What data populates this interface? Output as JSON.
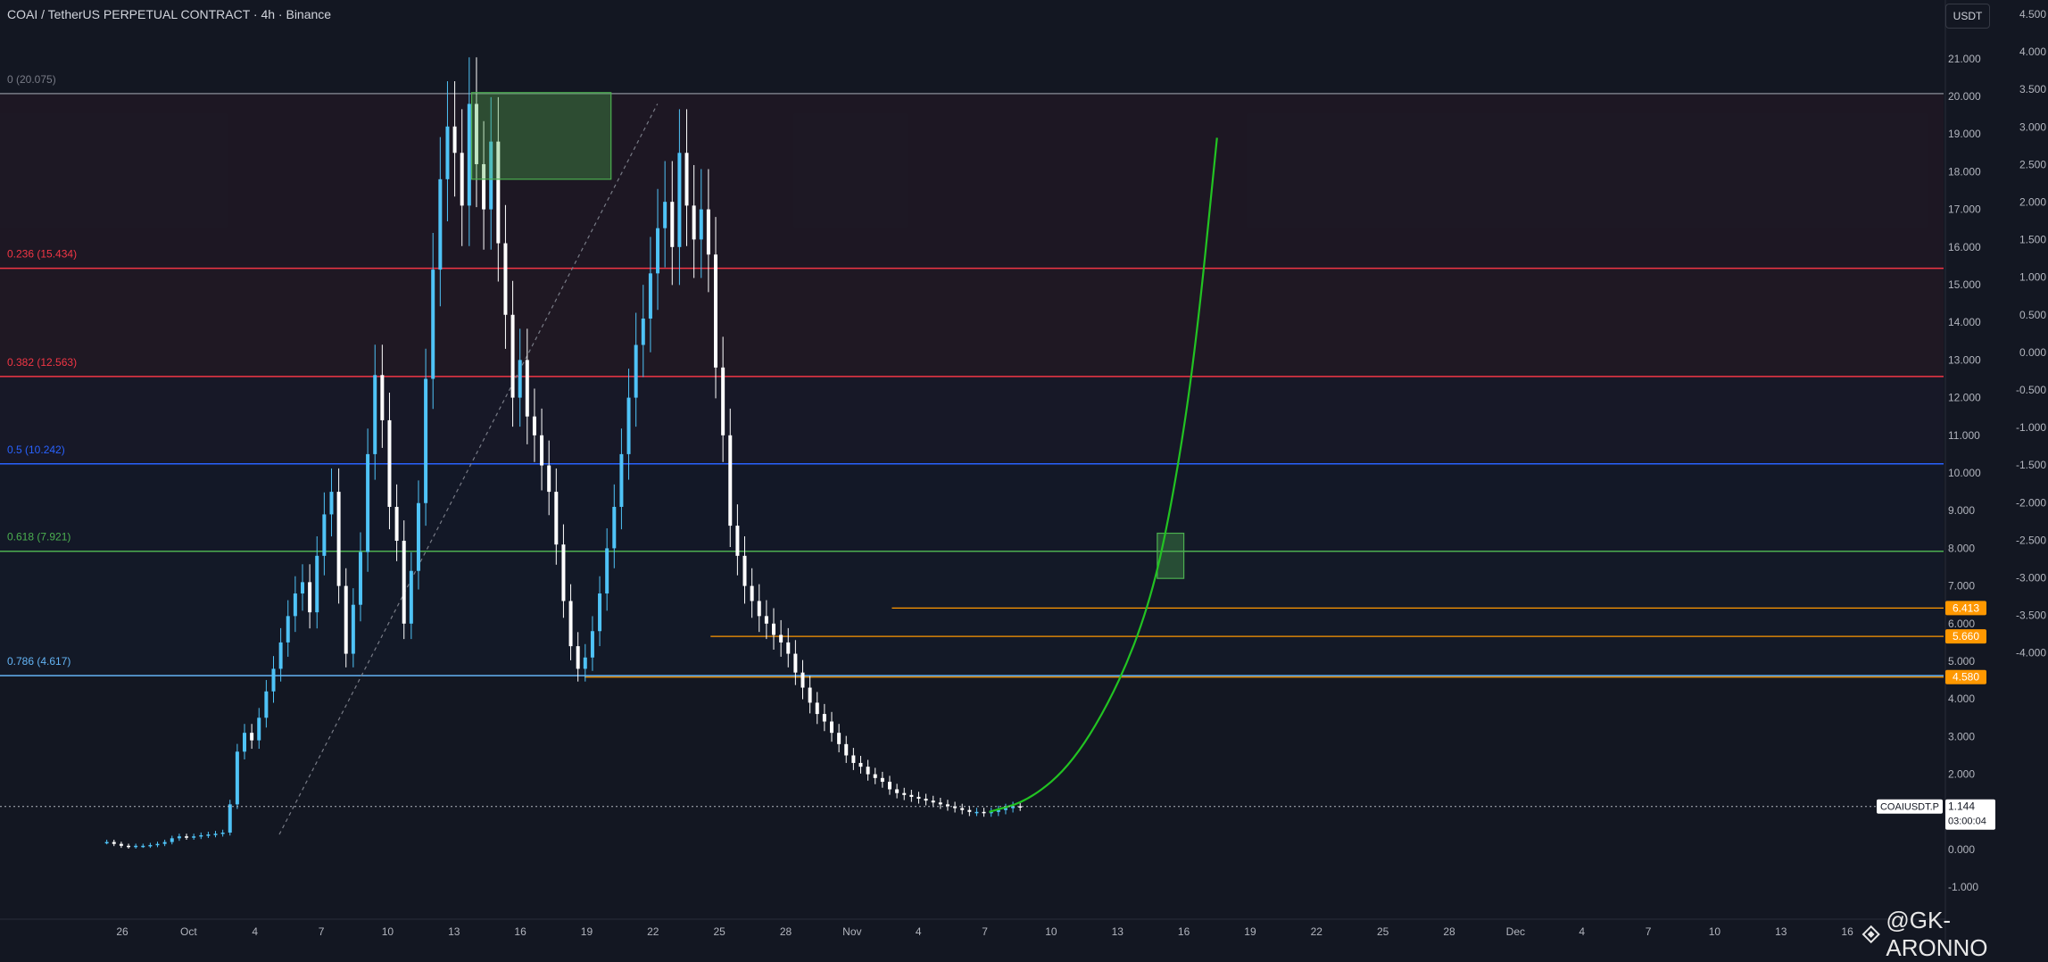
{
  "header": {
    "title": "COAI / TetherUS PERPETUAL CONTRACT · 4h · Binance",
    "currency": "USDT"
  },
  "watermark": "@GK-ARONNO",
  "colors": {
    "background": "#131722",
    "candle": "#4fc3f7",
    "fib_0": "#787b86",
    "fib_236": "#f23645",
    "fib_382": "#f23645",
    "fib_5": "#2962ff",
    "fib_618": "#4caf50",
    "fib_786": "#64b5f6",
    "orange": "#ff9800",
    "projection": "#22c322",
    "zone_fill": "rgba(76,175,80,0.35)"
  },
  "chart_data": {
    "type": "candlestick",
    "title": "COAI / TetherUS PERPETUAL CONTRACT · 4h · Binance",
    "x_ticks": [
      "26",
      "Oct",
      "4",
      "7",
      "10",
      "13",
      "16",
      "19",
      "22",
      "25",
      "28",
      "Nov",
      "4",
      "7",
      "10",
      "13",
      "16",
      "19",
      "22",
      "25",
      "28",
      "Dec",
      "4",
      "7",
      "10",
      "13",
      "16"
    ],
    "y_ticks_price": [
      "21.000",
      "20.000",
      "19.000",
      "18.000",
      "17.000",
      "16.000",
      "15.000",
      "14.000",
      "13.000",
      "12.000",
      "11.000",
      "10.000",
      "9.000",
      "8.000",
      "7.000",
      "6.000",
      "5.000",
      "4.000",
      "3.000",
      "2.000",
      "1.000",
      "0.000",
      "-1.000"
    ],
    "y_ticks_secondary": [
      "4.500",
      "4.000",
      "3.500",
      "3.000",
      "2.500",
      "2.000",
      "1.500",
      "1.000",
      "0.500",
      "0.000",
      "-0.500",
      "-1.000",
      "-1.500",
      "-2.000",
      "-2.500",
      "-3.000",
      "-3.500",
      "-4.000"
    ],
    "ylim": [
      -1.6,
      21.8
    ],
    "fib_levels": [
      {
        "label": "0 (20.075)",
        "value": 20.075
      },
      {
        "label": "0.236 (15.434)",
        "value": 15.434
      },
      {
        "label": "0.382 (12.563)",
        "value": 12.563
      },
      {
        "label": "0.5 (10.242)",
        "value": 10.242
      },
      {
        "label": "0.618 (7.921)",
        "value": 7.921
      },
      {
        "label": "0.786 (4.617)",
        "value": 4.617
      }
    ],
    "price_levels": [
      {
        "label": "6.413",
        "value": 6.413
      },
      {
        "label": "5.660",
        "value": 5.66
      },
      {
        "label": "4.580",
        "value": 4.58
      }
    ],
    "current_price": {
      "symbol": "COAIUSDT.P",
      "value": "1.144",
      "countdown": "03:00:04"
    },
    "zones": [
      {
        "x0": 15.8,
        "x1": 22.1,
        "y0": 17.8,
        "y1": 20.1
      },
      {
        "x0": 46.8,
        "x1": 48.0,
        "y0": 7.2,
        "y1": 8.4
      }
    ],
    "diagonal": {
      "x0": 7.1,
      "y0": 0.4,
      "x1": 24.2,
      "y1": 19.8
    },
    "projection_curve": {
      "points": [
        [
          39.2,
          1.0
        ],
        [
          41.0,
          1.3
        ],
        [
          43.0,
          2.3
        ],
        [
          45.0,
          4.3
        ],
        [
          46.5,
          6.6
        ],
        [
          47.5,
          9.3
        ],
        [
          48.5,
          13.1
        ],
        [
          49.5,
          18.9
        ]
      ]
    },
    "candles_close": [
      0.2,
      0.15,
      0.1,
      0.08,
      0.1,
      0.1,
      0.12,
      0.15,
      0.2,
      0.3,
      0.35,
      0.33,
      0.35,
      0.38,
      0.4,
      0.42,
      0.45,
      1.2,
      2.6,
      3.1,
      2.9,
      3.5,
      4.2,
      4.8,
      5.5,
      6.2,
      6.8,
      7.1,
      6.3,
      7.8,
      8.9,
      9.5,
      7.0,
      5.2,
      6.5,
      7.9,
      10.5,
      12.6,
      11.4,
      9.1,
      8.2,
      6.0,
      7.4,
      9.2,
      12.5,
      15.4,
      17.8,
      19.2,
      18.5,
      17.1,
      19.8,
      18.2,
      17.0,
      18.8,
      16.1,
      14.2,
      12.0,
      13.0,
      11.5,
      11.0,
      10.2,
      9.5,
      8.1,
      6.6,
      5.4,
      4.8,
      5.1,
      5.8,
      6.8,
      8.0,
      9.1,
      10.5,
      12.0,
      13.4,
      14.1,
      15.3,
      16.5,
      17.2,
      16.0,
      18.5,
      17.1,
      16.2,
      17.0,
      15.8,
      12.8,
      11.0,
      8.6,
      7.8,
      7.0,
      6.6,
      6.2,
      6.0,
      5.7,
      5.5,
      5.2,
      4.7,
      4.3,
      3.9,
      3.6,
      3.4,
      3.1,
      2.8,
      2.5,
      2.3,
      2.2,
      2.0,
      1.9,
      1.8,
      1.6,
      1.5,
      1.45,
      1.4,
      1.35,
      1.3,
      1.25,
      1.2,
      1.15,
      1.1,
      1.05,
      1.0,
      1.0,
      0.98,
      1.0,
      1.05,
      1.1,
      1.15,
      1.144
    ]
  }
}
